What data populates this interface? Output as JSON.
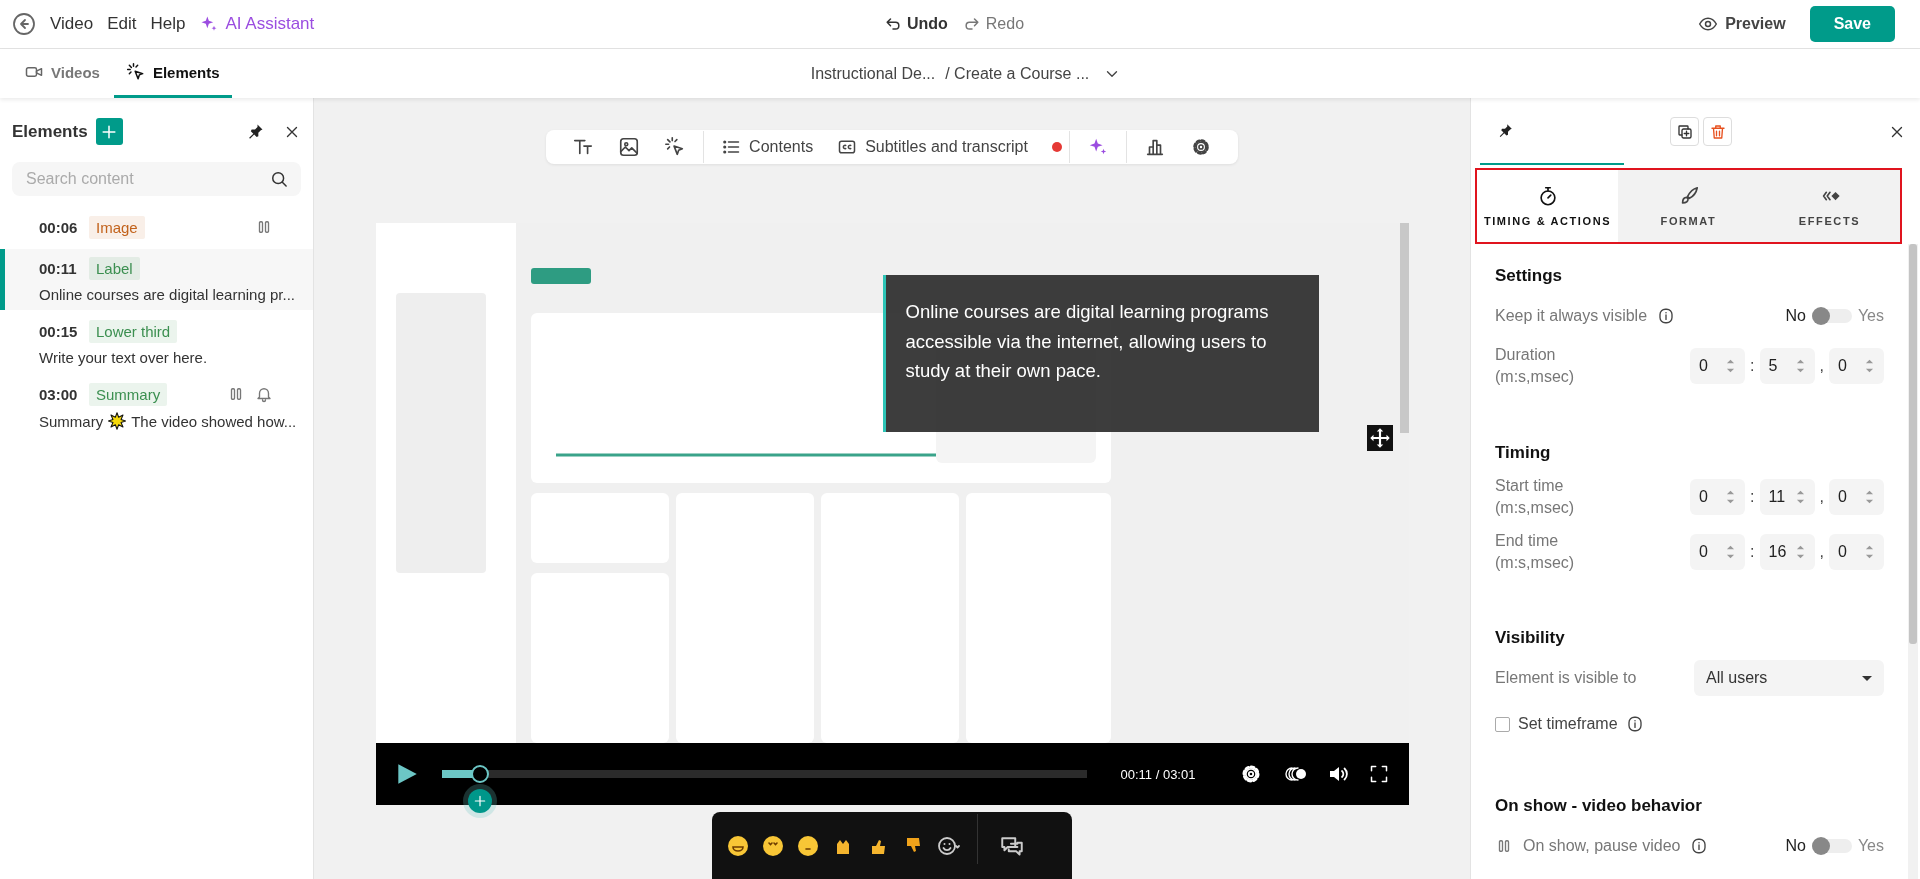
{
  "topbar": {
    "menu": [
      "Video",
      "Edit",
      "Help"
    ],
    "ai_assistant": "AI Assistant",
    "undo": "Undo",
    "redo": "Redo",
    "preview": "Preview",
    "save": "Save"
  },
  "subbar": {
    "tabs": [
      {
        "label": "Videos",
        "selected": false
      },
      {
        "label": "Elements",
        "selected": true
      }
    ],
    "breadcrumb": [
      "Instructional De...",
      "/ Create a Course ..."
    ]
  },
  "elements_panel": {
    "title": "Elements",
    "search": {
      "placeholder": "Search content"
    },
    "items": [
      {
        "time": "00:06",
        "tag": {
          "label": "Image",
          "color": "#c2621b"
        },
        "selected": false,
        "pause_icon": true
      },
      {
        "time": "00:11",
        "tag": {
          "label": "Label",
          "color": "#3b8f50"
        },
        "selected": true,
        "text_parts": [
          "Online courses are digital learning pr..."
        ]
      },
      {
        "time": "00:15",
        "tag": {
          "label": "Lower third",
          "color": "#3b8f50"
        },
        "selected": false,
        "text_parts": [
          "Write your text over here."
        ]
      },
      {
        "time": "03:00",
        "tag": {
          "label": "Summary",
          "color": "#3b8f50"
        },
        "selected": false,
        "pause_icon": true,
        "bell_icon": true,
        "text_parts": [
          "Summary",
          "The video showed how..."
        ]
      }
    ]
  },
  "canvas": {
    "toolbar": {
      "labeled_buttons": [
        {
          "label": "Contents"
        },
        {
          "label": "Subtitles and transcript",
          "recording": true
        }
      ]
    },
    "video": {
      "kind": "picture",
      "overlay_label": "Online courses are digital learning programs accessible via the internet, allowing users to study at their own pace.",
      "player": {
        "level": 0.06,
        "time": "00:11 / 03:01"
      }
    }
  },
  "props_panel": {
    "tabs_highlighted": true,
    "tabs": [
      {
        "label": "TIMING & ACTIONS",
        "selected": true
      },
      {
        "label": "FORMAT",
        "selected": false
      },
      {
        "label": "EFFECTS",
        "selected": false
      }
    ],
    "sections": [
      {
        "title": "Settings",
        "rows": [
          {
            "kind": "toggle",
            "label": "Keep it always visible",
            "info": true,
            "off_label": "No",
            "on_label": "Yes",
            "on": false
          },
          {
            "kind": "time",
            "label": "Duration",
            "sublabel": "(m:s,msec)",
            "values": [
              "0",
              "5",
              "0"
            ],
            "separators": [
              ":",
              ","
            ]
          }
        ]
      },
      {
        "title": "Timing",
        "rows": [
          {
            "kind": "time",
            "label": "Start time",
            "sublabel": "(m:s,msec)",
            "values": [
              "0",
              "11",
              "0"
            ],
            "separators": [
              ":",
              ","
            ]
          },
          {
            "kind": "time",
            "label": "End time",
            "sublabel": "(m:s,msec)",
            "values": [
              "0",
              "16",
              "0"
            ],
            "separators": [
              ":",
              ","
            ]
          }
        ]
      },
      {
        "title": "Visibility",
        "rows": [
          {
            "kind": "select",
            "label": "Element is visible to",
            "value": "All users"
          },
          {
            "kind": "checkbox",
            "label": "Set timeframe",
            "info": true,
            "checked": false
          }
        ]
      },
      {
        "title": "On show - video behavior",
        "rows": [
          {
            "kind": "toggle",
            "label": "On show, pause video",
            "pause_icon": true,
            "info": true,
            "off_label": "No",
            "on_label": "Yes",
            "on": false
          }
        ]
      }
    ]
  }
}
